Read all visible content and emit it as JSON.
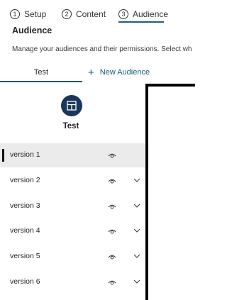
{
  "stepper": {
    "steps": [
      {
        "number": "1",
        "label": "Setup"
      },
      {
        "number": "2",
        "label": "Content"
      },
      {
        "number": "3",
        "label": "Audience",
        "active": true
      }
    ]
  },
  "page": {
    "title": "Audience",
    "description": "Manage your audiences and their permissions. Select wh"
  },
  "tabs": {
    "active": "Test",
    "new_audience_label": "New Audience"
  },
  "audience": {
    "name": "Test",
    "icon": "layout-grid-icon",
    "avatar_color": "#1b365d"
  },
  "versions": [
    {
      "label": "version 1",
      "selected": true,
      "expand": false
    },
    {
      "label": "version 2",
      "selected": false,
      "expand": true
    },
    {
      "label": "version 3",
      "selected": false,
      "expand": true
    },
    {
      "label": "version 4",
      "selected": false,
      "expand": true
    },
    {
      "label": "version 5",
      "selected": false,
      "expand": true
    },
    {
      "label": "version 6",
      "selected": false,
      "expand": true
    }
  ],
  "colors": {
    "accent": "#1f5f7a",
    "link": "#0f5c79",
    "selected_row": "#ebebeb"
  }
}
